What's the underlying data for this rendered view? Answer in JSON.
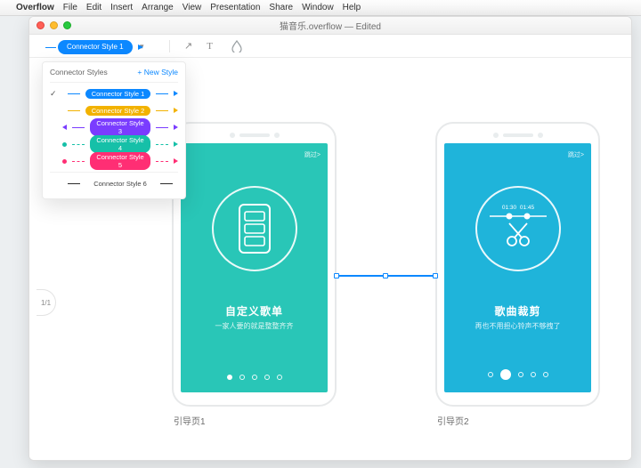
{
  "menubar": {
    "appname": "Overflow",
    "items": [
      "File",
      "Edit",
      "Insert",
      "Arrange",
      "View",
      "Presentation",
      "Share",
      "Window",
      "Help"
    ]
  },
  "window": {
    "title": "猫音乐.overflow — Edited"
  },
  "toolbar": {
    "connector_label": "Connector Style 1"
  },
  "styles_panel": {
    "title": "Connector Styles",
    "new_label": "+  New Style",
    "rows": [
      {
        "label": "Connector Style 1",
        "color": "#0c88ff",
        "selected": true,
        "dashed": false,
        "start": "line",
        "end": "arrow"
      },
      {
        "label": "Connector Style 2",
        "color": "#f2b200",
        "selected": false,
        "dashed": false,
        "start": "line",
        "end": "arrow"
      },
      {
        "label": "Connector Style 3",
        "color": "#7a3cff",
        "selected": false,
        "dashed": false,
        "start": "arrow",
        "end": "arrow"
      },
      {
        "label": "Connector Style 4",
        "color": "#16c0a8",
        "selected": false,
        "dashed": true,
        "start": "dot",
        "end": "arrow"
      },
      {
        "label": "Connector Style 5",
        "color": "#ff2e74",
        "selected": false,
        "dashed": true,
        "start": "dot",
        "end": "arrow"
      },
      {
        "label": "Connector Style 6",
        "color": "#2b2b2b",
        "selected": false,
        "dashed": false,
        "start": "line",
        "end": "line"
      }
    ]
  },
  "page_indicator": "1/1",
  "phones": {
    "left": {
      "bg": "#29c6b7",
      "skip": "跳过>",
      "title": "自定义歌单",
      "subtitle": "一家人要的就是整整齐齐",
      "caption": "引导页1",
      "dots_active_index": 0,
      "dots_total": 5
    },
    "right": {
      "bg": "#1fb4da",
      "skip": "跳过>",
      "time_a": "01:30",
      "time_b": "01:45",
      "title": "歌曲裁剪",
      "subtitle": "再也不用担心铃声不够拽了",
      "caption": "引导页2",
      "dots_active_index": 1,
      "dots_total": 5
    }
  }
}
